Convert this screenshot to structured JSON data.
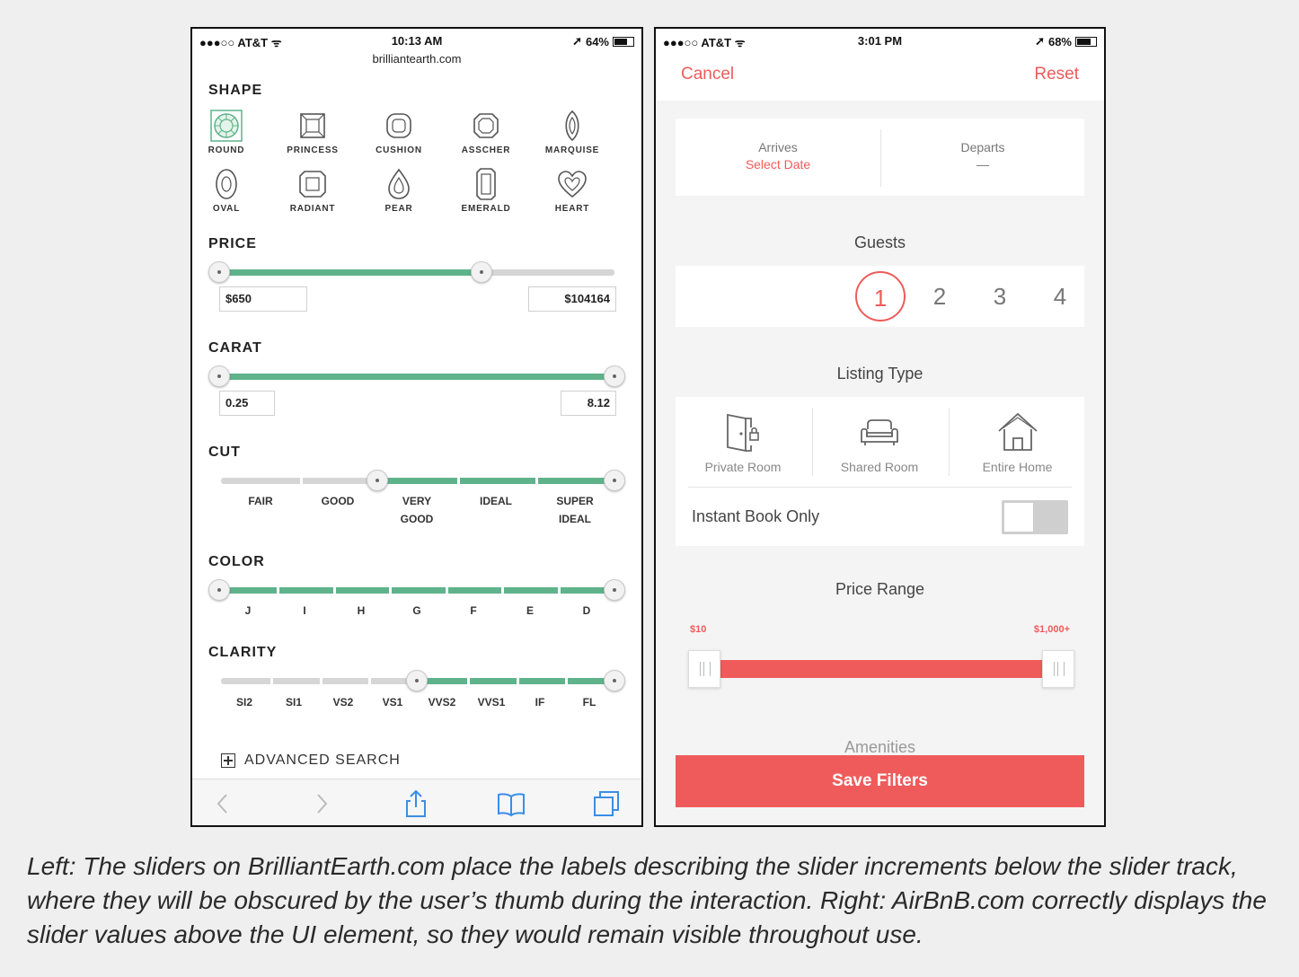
{
  "left": {
    "status": {
      "carrier": "●●●○○ AT&T ᯤ",
      "time": "10:13 AM",
      "battery": "64%",
      "battery_level": 0.64
    },
    "url": "brilliantearth.com",
    "shape": {
      "title": "SHAPE",
      "items": [
        "ROUND",
        "PRINCESS",
        "CUSHION",
        "ASSCHER",
        "MARQUISE",
        "OVAL",
        "RADIANT",
        "PEAR",
        "EMERALD",
        "HEART"
      ],
      "selected": "ROUND"
    },
    "price": {
      "title": "PRICE",
      "min": "$650",
      "max": "$104164",
      "upper_fraction": 0.66
    },
    "carat": {
      "title": "CARAT",
      "min": "0.25",
      "max": "8.12"
    },
    "cut": {
      "title": "CUT",
      "ticks": [
        "FAIR",
        "GOOD",
        "VERY\nGOOD",
        "IDEAL",
        "SUPER\nIDEAL"
      ],
      "selected_from": "VERY GOOD",
      "selected_to": "SUPER IDEAL"
    },
    "color": {
      "title": "COLOR",
      "ticks": [
        "J",
        "I",
        "H",
        "G",
        "F",
        "E",
        "D"
      ]
    },
    "clarity": {
      "title": "CLARITY",
      "ticks": [
        "SI2",
        "SI1",
        "VS2",
        "VS1",
        "VVS2",
        "VVS1",
        "IF",
        "FL"
      ],
      "selected_from": "VVS2",
      "selected_to": "FL"
    },
    "advanced": "ADVANCED SEARCH",
    "toolbar": [
      "back-icon",
      "forward-icon",
      "share-icon",
      "bookmarks-icon",
      "tabs-icon"
    ]
  },
  "right": {
    "status": {
      "carrier": "●●●○○ AT&T ᯤ",
      "time": "3:01 PM",
      "battery": "68%",
      "battery_level": 0.68
    },
    "cancel": "Cancel",
    "reset": "Reset",
    "arrives": {
      "label": "Arrives",
      "value": "Select Date"
    },
    "departs": {
      "label": "Departs",
      "value": "—"
    },
    "guests": {
      "title": "Guests",
      "options": [
        "1",
        "2",
        "3",
        "4"
      ],
      "selected": "1"
    },
    "listing": {
      "title": "Listing Type",
      "types": [
        "Private Room",
        "Shared Room",
        "Entire Home"
      ]
    },
    "instant_book": "Instant Book Only",
    "price_range": {
      "title": "Price Range",
      "min": "$10",
      "max": "$1,000+"
    },
    "amenities": "Amenities",
    "save": "Save Filters",
    "accent": "#ef5b5b"
  },
  "caption": "Left: The sliders on BrilliantEarth.com place the labels describing the slider increments below the slider track, where they will be obscured by the user’s thumb during the interaction. Right: AirBnB.com correctly displays the slider values above the UI element, so they would remain visible throughout use."
}
